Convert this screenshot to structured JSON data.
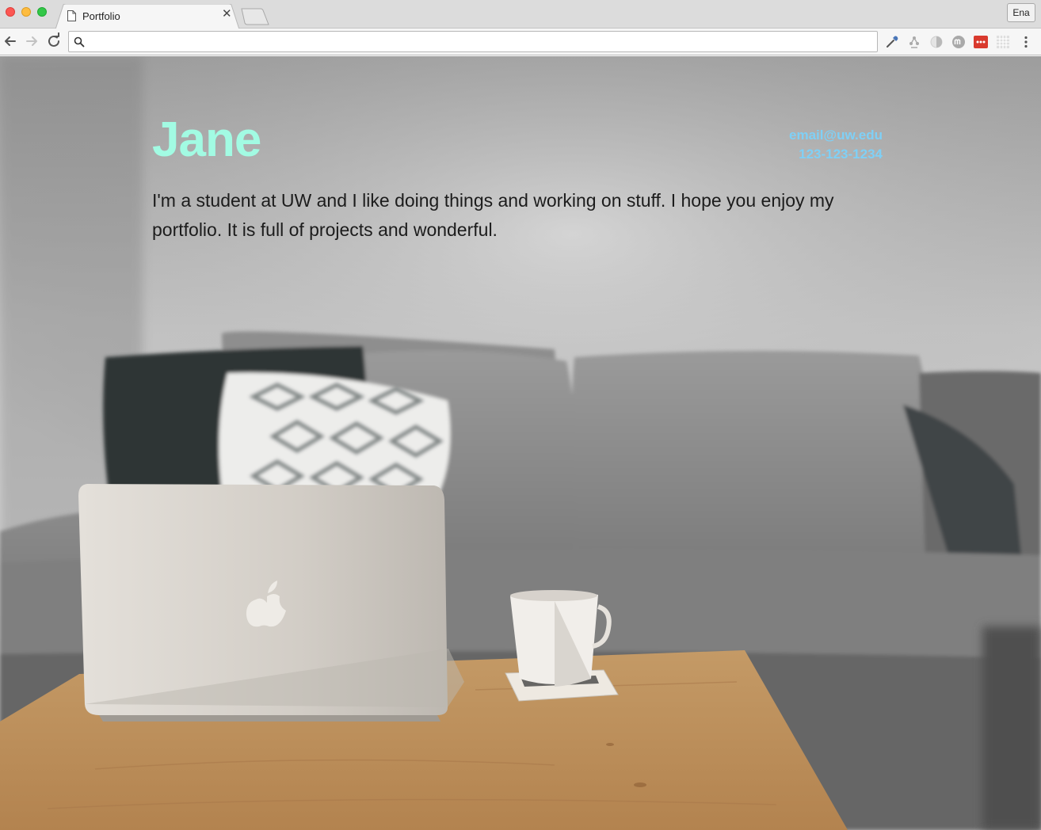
{
  "browser": {
    "tab_title": "Portfolio",
    "profile_label": "Ena",
    "address_value": "",
    "address_placeholder": ""
  },
  "page": {
    "name": "Jane",
    "email": "email@uw.edu",
    "phone": "123-123-1234",
    "bio": "I'm a student at UW and I like doing things and working on stuff. I hope you enjoy my portfolio. It is full of projects and wonderful."
  },
  "icons": [
    "page-icon",
    "close-icon",
    "back-arrow-icon",
    "forward-arrow-icon",
    "reload-icon",
    "search-icon",
    "eyedropper-icon",
    "tree-icon",
    "half-circle-icon",
    "m-logo-icon",
    "red-dots-icon",
    "grid-icon",
    "kebab-menu-icon",
    "apple-logo-icon"
  ],
  "colors": {
    "name": "#a2fbe3",
    "contact": "#7fd0f6",
    "bio": "#1c1c1c"
  }
}
